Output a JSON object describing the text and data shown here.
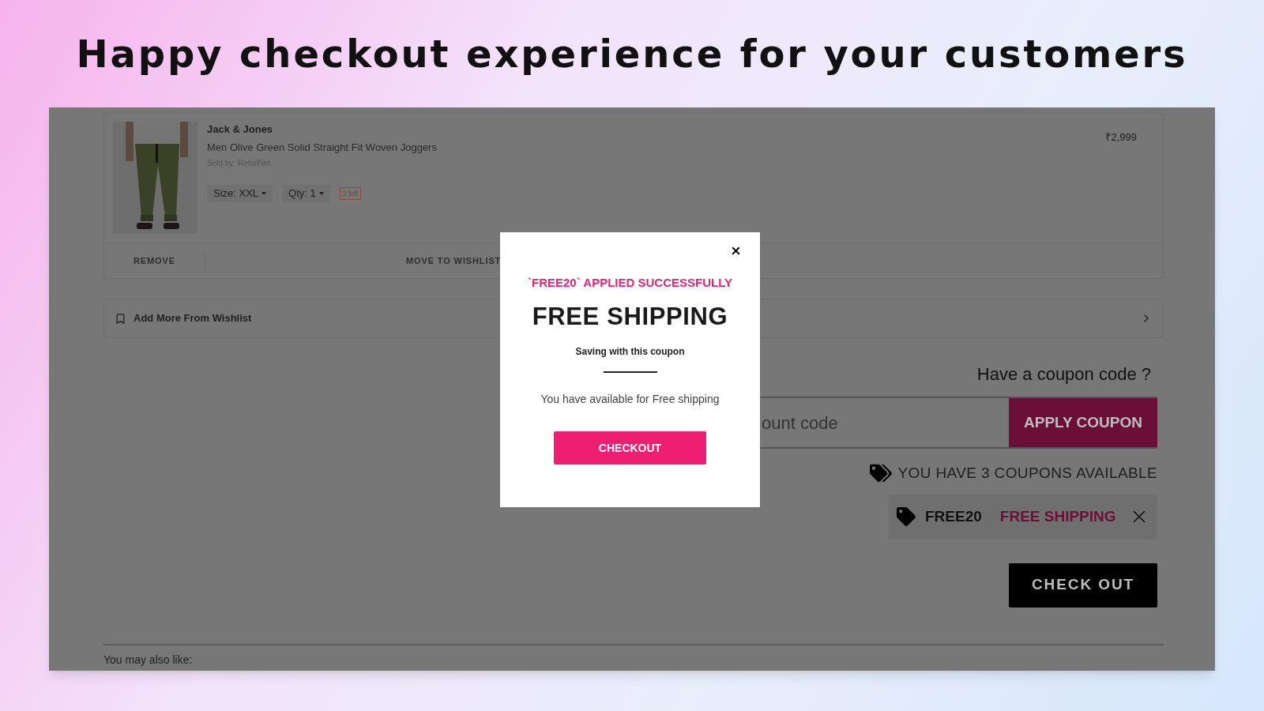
{
  "heading": "Happy checkout experience for your customers",
  "cart_item": {
    "brand": "Jack & Jones",
    "title": "Men Olive Green Solid Straight Fit Woven Joggers",
    "seller": "Sold by: RetailNet",
    "price": "₹2,999",
    "size": "Size: XXL",
    "qty": "Qty: 1",
    "stock_badge": "2 left",
    "actions": [
      "REMOVE",
      "MOVE TO WISHLIST"
    ]
  },
  "wishlist_link": "Add More From Wishlist",
  "coupon": {
    "prompt": "Have a coupon code ?",
    "placeholder": "ount code",
    "apply_button": "APPLY COUPON",
    "available_text": "YOU HAVE 3 COUPONS AVAILABLE",
    "applied": {
      "code": "FREE20",
      "benefit": "FREE SHIPPING"
    }
  },
  "checkout_button": "CHECK OUT",
  "recommendations_title": "You may also like:",
  "modal": {
    "status": "`FREE20` APPLIED SUCCESSFULLY",
    "title": "FREE SHIPPING",
    "subtitle": "Saving with this coupon",
    "message": "You have available for Free shipping",
    "button": "CHECKOUT"
  }
}
